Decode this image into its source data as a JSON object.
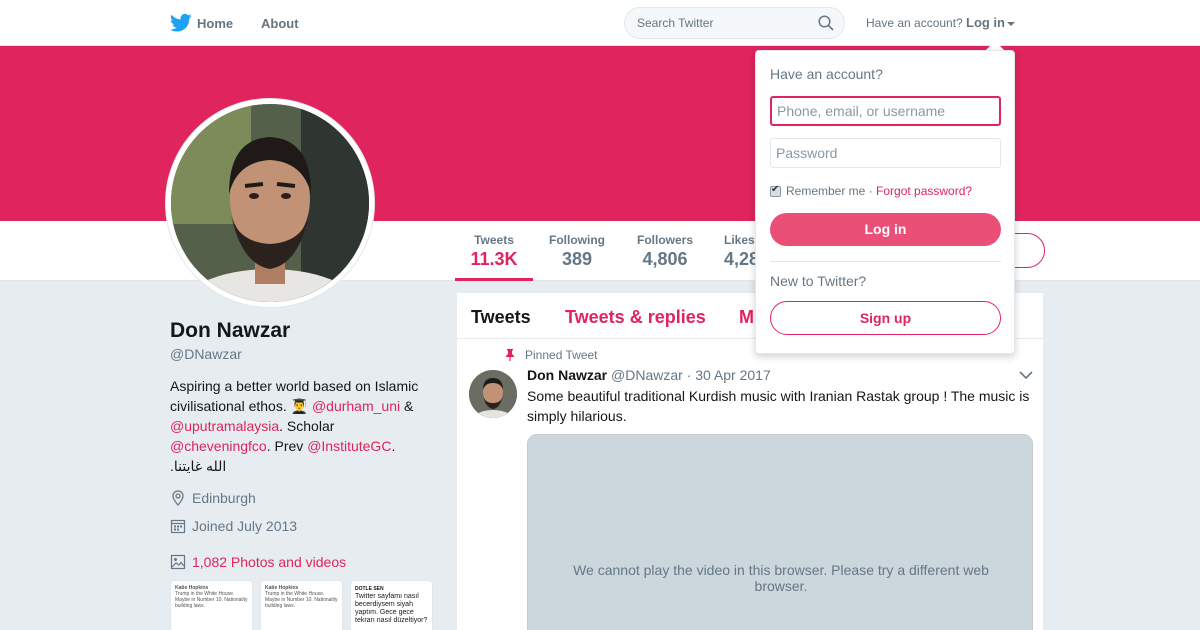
{
  "nav": {
    "home_label": "Home",
    "about_label": "About",
    "search_placeholder": "Search Twitter",
    "have_account": "Have an account?",
    "login_label": "Log in"
  },
  "profile": {
    "name": "Don Nawzar",
    "handle": "@DNawzar",
    "bio": {
      "line1": "Aspiring a better world based on Islamic civilisational ethos.",
      "emoji": "👨‍🎓",
      "link1": "@durham_uni",
      "amp": "&",
      "link2": "@uputramalaysia",
      "scholar": ". Scholar",
      "link3": "@cheveningfco",
      "prev": ". Prev",
      "link4": "@InstituteGC",
      "dot": ".",
      "arabic": "الله غايتنا."
    },
    "location": "Edinburgh",
    "joined": "Joined July 2013",
    "photos": "1,082 Photos and videos"
  },
  "stats": [
    {
      "label": "Tweets",
      "value": "11.3K"
    },
    {
      "label": "Following",
      "value": "389"
    },
    {
      "label": "Followers",
      "value": "4,806"
    },
    {
      "label": "Likes",
      "value": "4,28"
    }
  ],
  "timeline": {
    "tabs": [
      "Tweets",
      "Tweets & replies",
      "M"
    ],
    "tweet": {
      "pinned_label": "Pinned Tweet",
      "name": "Don Nawzar",
      "handle": "@DNawzar",
      "date": "· 30 Apr 2017",
      "text": "Some beautiful traditional Kurdish music with Iranian Rastak group ! The music is simply hilarious.",
      "video_message": "We cannot play the video in this browser. Please try a different web browser."
    }
  },
  "thumbs": [
    {
      "title": "Katie Hopkins",
      "text": "Trump in the White House. Maybe in Number 10. Nationality building laws."
    },
    {
      "title": "Katie Hopkins",
      "text": "Trump in the White House. Maybe in Number 10. Nationality building laws."
    },
    {
      "title": "DOTLE SEN",
      "text": "Twitter sayfamı nasıl becerdiysem siyah yaptım. Gece gece tekrarı nasıl düzeltiyor?"
    }
  ],
  "login": {
    "title": "Have an account?",
    "username_placeholder": "Phone, email, or username",
    "password_placeholder": "Password",
    "remember": "Remember me",
    "sep": " · ",
    "forgot": "Forgot password?",
    "login_button": "Log in",
    "new_label": "New to Twitter?",
    "signup_button": "Sign up"
  },
  "colors": {
    "accent": "#e0245e",
    "banner": "#e0245e",
    "twitter_blue": "#1da1f2"
  }
}
